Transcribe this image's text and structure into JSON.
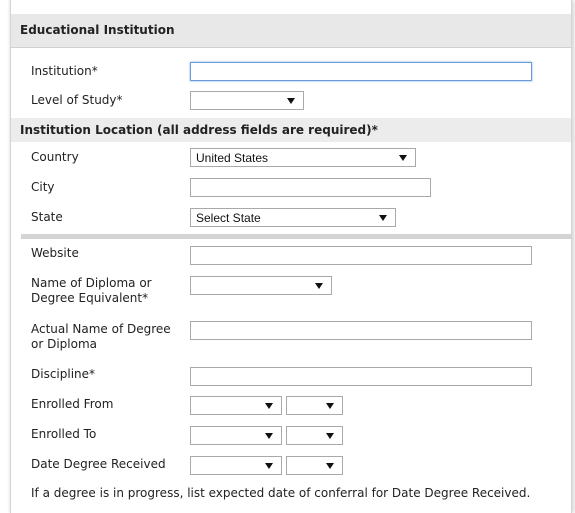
{
  "section": {
    "title": "Educational Institution"
  },
  "fields": {
    "institution": {
      "label": "Institution*",
      "value": ""
    },
    "level_of_study": {
      "label": "Level of Study*",
      "value": ""
    },
    "location_header": "Institution Location (all address fields are required)*",
    "country": {
      "label": "Country",
      "value": "United States"
    },
    "city": {
      "label": "City",
      "value": ""
    },
    "state": {
      "label": "State",
      "value": "Select State"
    },
    "website": {
      "label": "Website",
      "value": ""
    },
    "diploma_name": {
      "label_line1": "Name of Diploma or",
      "label_line2": "Degree Equivalent*",
      "value": ""
    },
    "actual_degree": {
      "label_line1": "Actual Name of Degree",
      "label_line2": "or Diploma",
      "value": ""
    },
    "discipline": {
      "label": "Discipline*",
      "value": ""
    },
    "enrolled_from": {
      "label": "Enrolled From",
      "month": "",
      "year": ""
    },
    "enrolled_to": {
      "label": "Enrolled To",
      "month": "",
      "year": ""
    },
    "date_received": {
      "label": "Date Degree Received",
      "month": "",
      "year": ""
    }
  },
  "note": "If a degree is in progress, list expected date of conferral for Date Degree Received."
}
